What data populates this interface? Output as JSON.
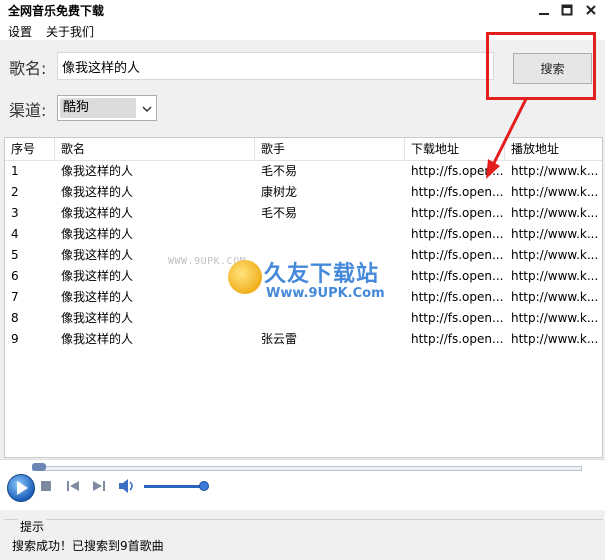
{
  "window": {
    "title": "全网音乐免费下载"
  },
  "menu": {
    "items": [
      "设置",
      "关于我们"
    ]
  },
  "form": {
    "song_label": "歌名:",
    "song_value": "像我这样的人",
    "search_button": "搜索",
    "channel_label": "渠道:",
    "channel_value": "酷狗"
  },
  "table": {
    "columns": [
      "序号",
      "歌名",
      "歌手",
      "下载地址",
      "播放地址"
    ],
    "rows": [
      {
        "no": "1",
        "title": "像我这样的人",
        "singer": "毛不易",
        "download": "http://fs.open...",
        "play": "http://www.k..."
      },
      {
        "no": "2",
        "title": "像我这样的人",
        "singer": "康树龙",
        "download": "http://fs.open...",
        "play": "http://www.k..."
      },
      {
        "no": "3",
        "title": "像我这样的人",
        "singer": "毛不易",
        "download": "http://fs.open...",
        "play": "http://www.k..."
      },
      {
        "no": "4",
        "title": "像我这样的人",
        "singer": "",
        "download": "http://fs.open...",
        "play": "http://www.k..."
      },
      {
        "no": "5",
        "title": "像我这样的人",
        "singer": "",
        "download": "http://fs.open...",
        "play": "http://www.k..."
      },
      {
        "no": "6",
        "title": "像我这样的人",
        "singer": "",
        "download": "http://fs.open...",
        "play": "http://www.k..."
      },
      {
        "no": "7",
        "title": "像我这样的人",
        "singer": "",
        "download": "http://fs.open...",
        "play": "http://www.k..."
      },
      {
        "no": "8",
        "title": "像我这样的人",
        "singer": "",
        "download": "http://fs.open...",
        "play": "http://www.k..."
      },
      {
        "no": "9",
        "title": "像我这样的人",
        "singer": "张云雷",
        "download": "http://fs.open...",
        "play": "http://www.k..."
      }
    ]
  },
  "player": {
    "seek_position": 0.0,
    "volume_level": 0.9
  },
  "status": {
    "title": "提示",
    "message": "搜索成功！已搜索到9首歌曲"
  },
  "watermark": {
    "small": "WWW.9UPK.COM",
    "main": "久友下载站",
    "url": "Www.9UPK.Com"
  },
  "colors": {
    "highlight": "#e41d1d",
    "accent": "#2c79d6"
  }
}
